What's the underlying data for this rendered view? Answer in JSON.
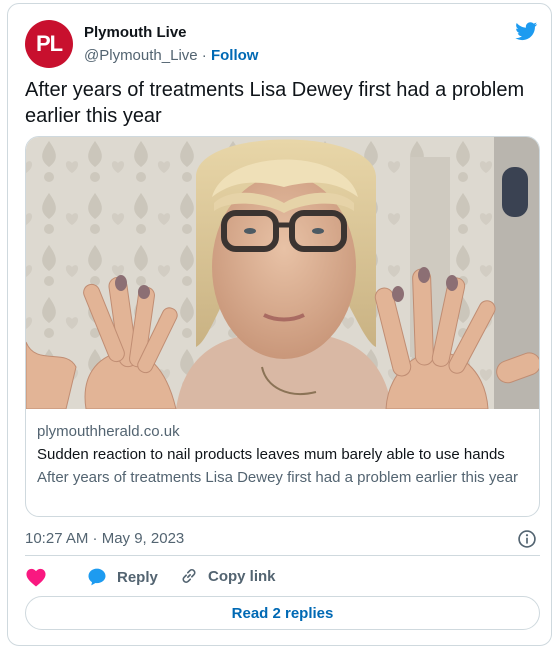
{
  "author": {
    "avatar_text": "PL",
    "name": "Plymouth Live",
    "handle": "@Plymouth_Live",
    "separator": "·",
    "follow_label": "Follow"
  },
  "tweet": {
    "text": "After years of treatments Lisa Dewey first had a problem earlier this year",
    "timestamp": "10:27 AM · May 9, 2023"
  },
  "link_card": {
    "domain": "plymouthherald.co.uk",
    "title": "Sudden reaction to nail products leaves mum barely able to use hands",
    "description": "After years of treatments Lisa Dewey first had a problem earlier this year"
  },
  "actions": {
    "like_label": "",
    "reply_label": "Reply",
    "copy_link_label": "Copy link"
  },
  "read_replies_label": "Read 2 replies",
  "colors": {
    "brand_red": "#c8102e",
    "link_blue": "#0069b4",
    "twitter_blue": "#1d9bf0",
    "like_pink": "#f91880",
    "muted_text": "#536471",
    "border": "#cfd9de"
  },
  "icons": [
    "twitter-bird-icon",
    "heart-icon",
    "reply-bubble-icon",
    "link-chain-icon",
    "info-icon"
  ]
}
